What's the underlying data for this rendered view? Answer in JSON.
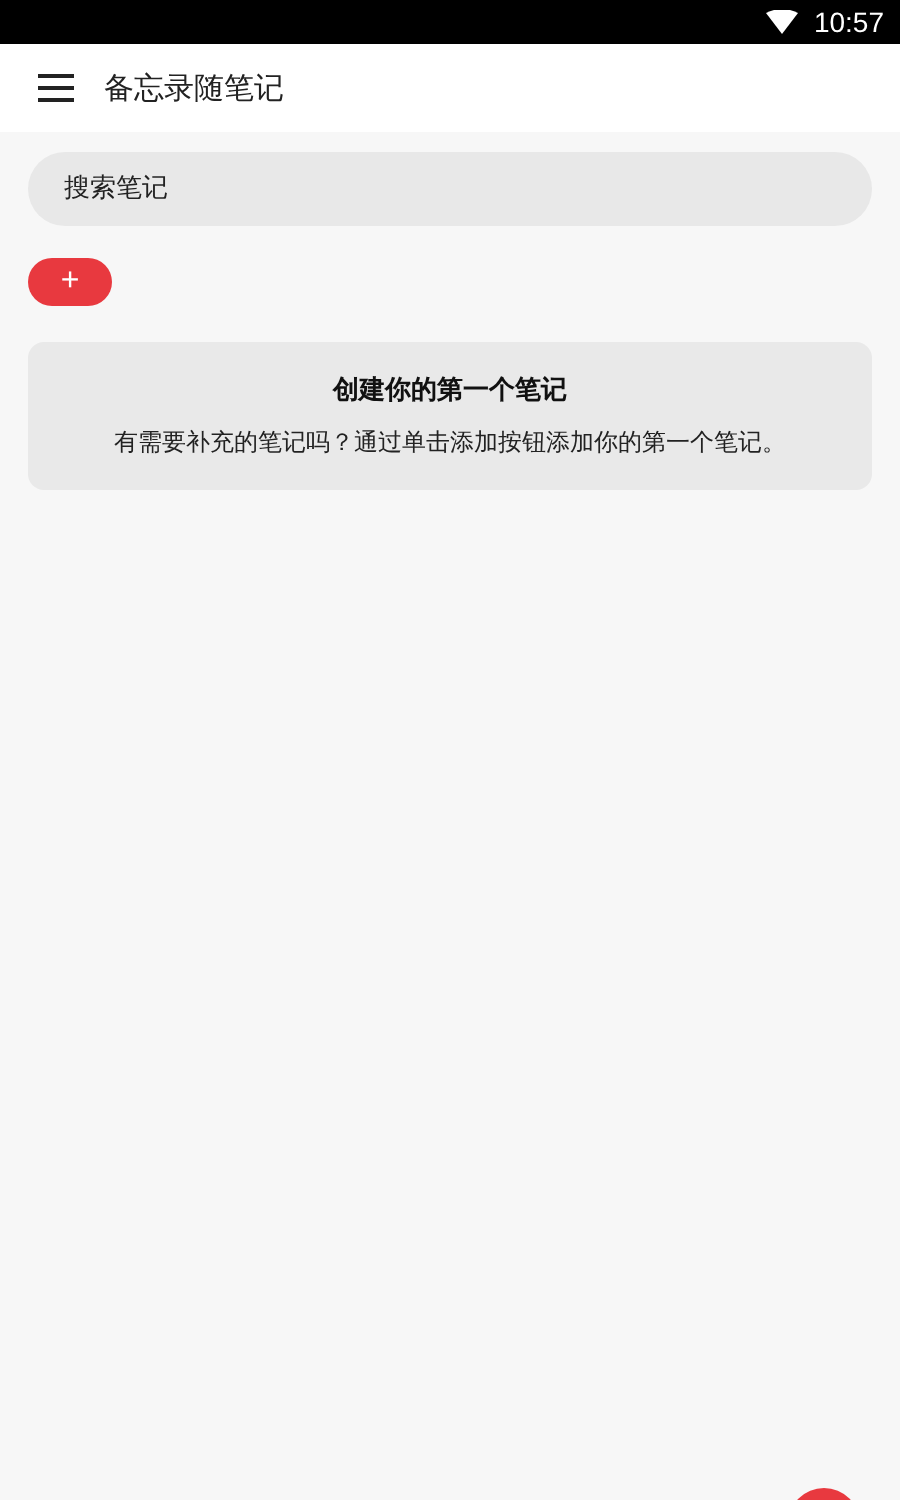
{
  "status_bar": {
    "time": "10:57"
  },
  "app_bar": {
    "title": "备忘录随笔记"
  },
  "search": {
    "placeholder": "搜索笔记"
  },
  "add_button": {
    "label": "+"
  },
  "empty_card": {
    "title": "创建你的第一个笔记",
    "message": "有需要补充的笔记吗？通过单击添加按钮添加你的第一个笔记。"
  }
}
